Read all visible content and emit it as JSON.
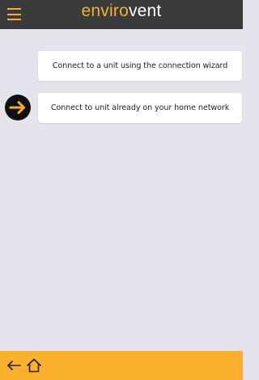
{
  "header": {
    "menu_icon": "hamburger-menu-icon",
    "logo_part_1": "enviro",
    "logo_part_2": "vent"
  },
  "main": {
    "options": [
      {
        "label": "Connect to a unit using the connection wizard"
      },
      {
        "label": "Connect to unit already on your home network"
      }
    ],
    "pointer_icon": "arrow-right-circle-icon"
  },
  "footer": {
    "back_icon": "back-arrow-icon",
    "home_icon": "home-icon"
  },
  "colors": {
    "accent": "#f6ad2b",
    "header_background": "#3b3b3b",
    "page_background": "#e3e4ec",
    "footer_background": "#fbb02e",
    "card_background": "#ffffff"
  }
}
